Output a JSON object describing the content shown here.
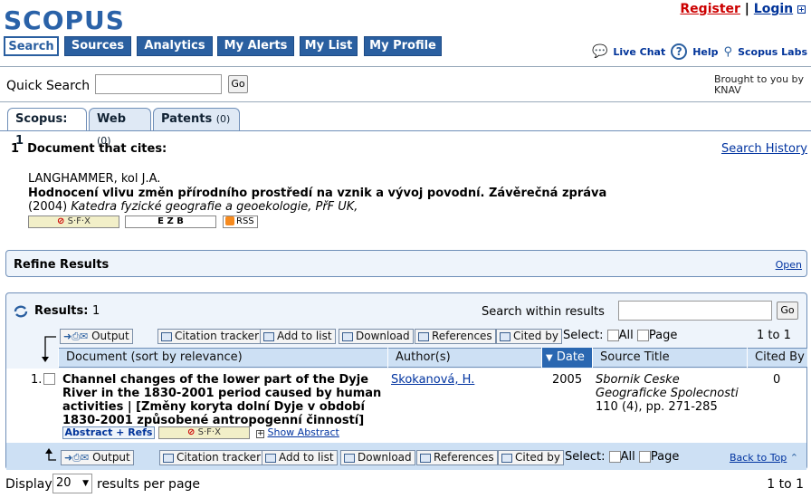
{
  "brand": "SCOPUS",
  "top_links": {
    "register": "Register",
    "sep": "|",
    "login": "Login"
  },
  "nav": [
    {
      "label": "Search"
    },
    {
      "label": "Sources"
    },
    {
      "label": "Analytics"
    },
    {
      "label": "My Alerts"
    },
    {
      "label": "My List"
    },
    {
      "label": "My Profile"
    }
  ],
  "help_links": {
    "live_chat": "Live Chat",
    "help": "Help",
    "labs": "Scopus Labs"
  },
  "quick_search": {
    "label": "Quick Search",
    "value": "",
    "go": "Go",
    "brought_by": "Brought to you by",
    "institution": "KNAV"
  },
  "result_tabs": [
    {
      "label": "Scopus: 1",
      "count": ""
    },
    {
      "label": "Web",
      "count": "(0)"
    },
    {
      "label": "Patents",
      "count": "(0)"
    }
  ],
  "cites_heading": "1  Document that cites:",
  "search_history": "Search History",
  "cited_doc": {
    "authors": "LANGHAMMER, kol J.A.",
    "title": "Hodnocení vlivu změn přírodního prostředí na vznik a vývoj povodní. Závěrečná zpráva",
    "year": "(2004)",
    "source": "Katedra fyzické geografie a geoekologie, PřF UK,"
  },
  "badges": {
    "sfx": "S·F·X",
    "ezb": "E Z B",
    "rss": "RSS"
  },
  "refine": {
    "title": "Refine Results",
    "open": "Open"
  },
  "results": {
    "label": "Results:",
    "count": "1",
    "search_within": "Search within results",
    "go": "Go",
    "toolbar": {
      "output": "Output",
      "citation_tracker": "Citation tracker",
      "add_to_list": "Add to list",
      "download": "Download",
      "references": "References",
      "cited_by": "Cited by"
    },
    "select": "Select:",
    "all": "All",
    "page": "Page",
    "range": "1 to 1",
    "columns": {
      "document": "Document (sort by relevance)",
      "authors": "Author(s)",
      "date": "Date",
      "source": "Source Title",
      "cited_by": "Cited By"
    },
    "rows": [
      {
        "num": "1.",
        "title": "Channel changes of the lower part of the Dyje River in the 1830-2001 period caused by human activities | [Změny koryta dolní Dyje v období 1830-2001 způsobené antropogenní činností]",
        "author": "Skokanová, H.",
        "year": "2005",
        "source": "Sbornik Ceske Geograficke Spolecnosti",
        "pages": "110 (4), pp. 271-285",
        "cited": "0",
        "abstract_refs": "Abstract + Refs",
        "show_abstract": "Show Abstract"
      }
    ],
    "back_to_top": "Back to Top"
  },
  "footer": {
    "display": "Display",
    "per_page": "20",
    "per_page_label": "results per page",
    "range": "1 to 1"
  }
}
